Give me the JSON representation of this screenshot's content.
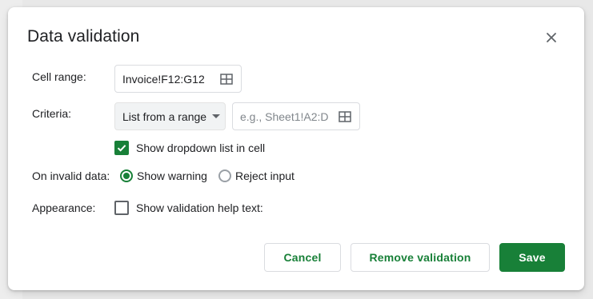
{
  "dialog": {
    "title": "Data validation",
    "close_icon": "close-icon"
  },
  "cell_range": {
    "label": "Cell range:",
    "value": "Invoice!F12:G12",
    "icon": "grid-select-icon"
  },
  "criteria": {
    "label": "Criteria:",
    "selected": "List from a range",
    "range_placeholder": "e.g., Sheet1!A2:D",
    "show_dropdown": {
      "label": "Show dropdown list in cell",
      "checked": true
    }
  },
  "on_invalid": {
    "label": "On invalid data:",
    "options": [
      {
        "label": "Show warning",
        "selected": true
      },
      {
        "label": "Reject input",
        "selected": false
      }
    ]
  },
  "appearance": {
    "label": "Appearance:",
    "help_text": {
      "label": "Show validation help text:",
      "checked": false
    }
  },
  "buttons": {
    "cancel": "Cancel",
    "remove": "Remove validation",
    "save": "Save"
  },
  "colors": {
    "accent": "#188038",
    "text": "#202124",
    "border": "#dadce0"
  }
}
